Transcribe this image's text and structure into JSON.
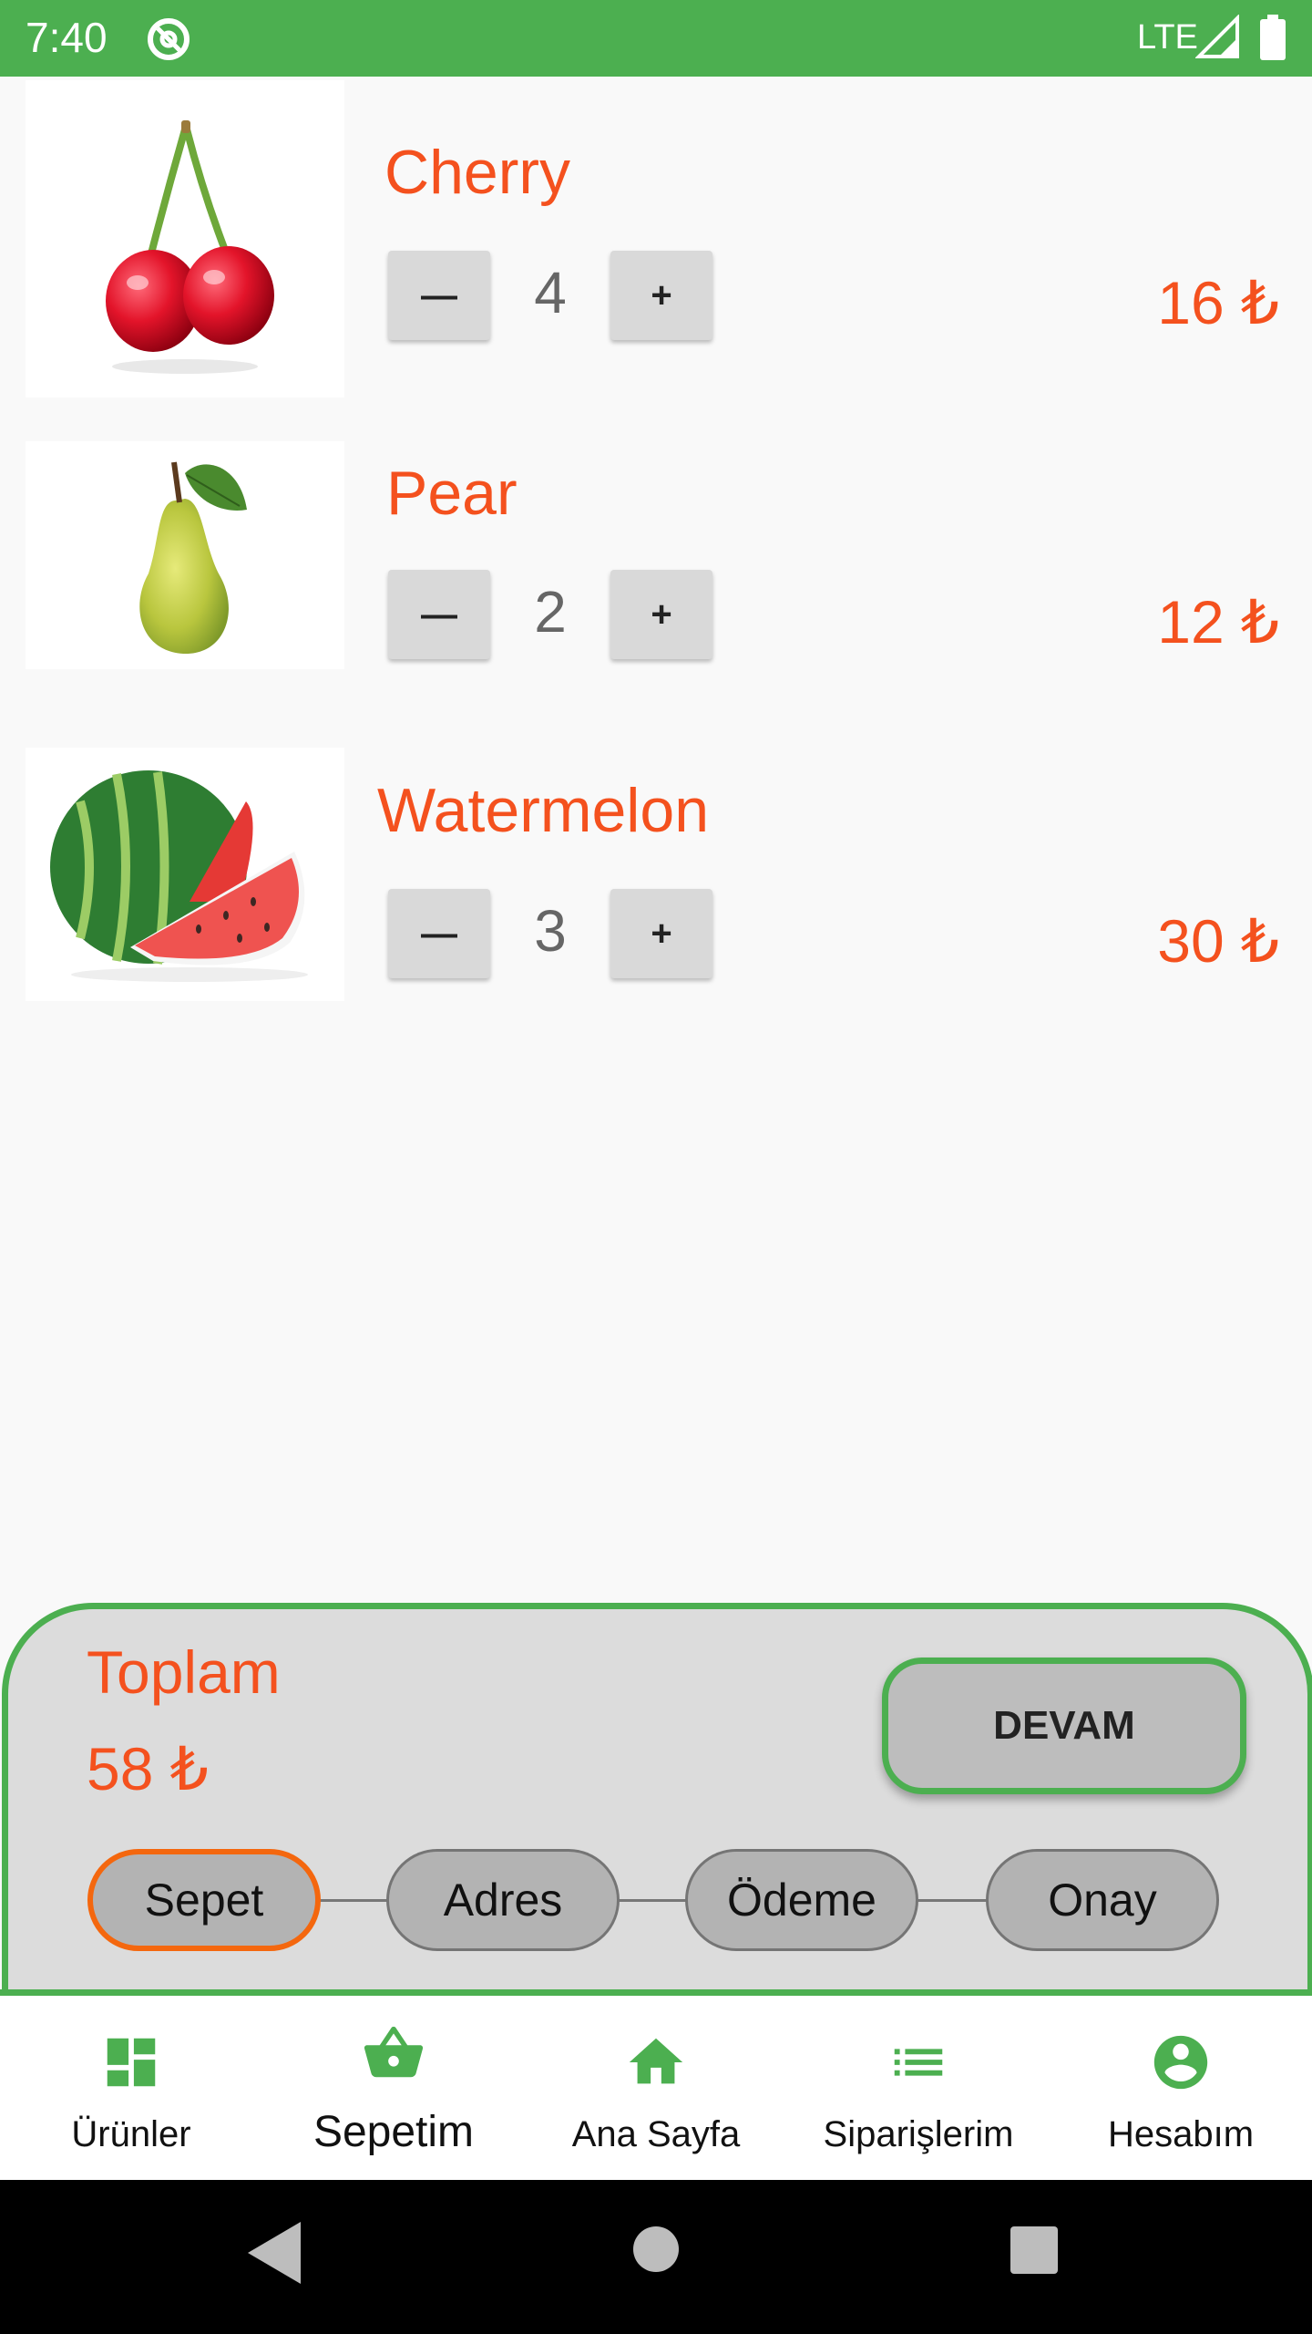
{
  "status_bar": {
    "time": "7:40",
    "network": "LTE",
    "background_color": "#4caf50"
  },
  "cart": {
    "items": [
      {
        "name": "Cherry",
        "quantity": "4",
        "price": "16 ₺",
        "image_icon": "cherry-image"
      },
      {
        "name": "Pear",
        "quantity": "2",
        "price": "12 ₺",
        "image_icon": "pear-image"
      },
      {
        "name": "Watermelon",
        "quantity": "3",
        "price": "30 ₺",
        "image_icon": "watermelon-image"
      }
    ],
    "minus_label": "—",
    "plus_label": "+"
  },
  "summary": {
    "total_label": "Toplam",
    "total_value": "58 ₺",
    "continue_label": "DEVAM",
    "steps": [
      {
        "label": "Sepet",
        "active": true
      },
      {
        "label": "Adres",
        "active": false
      },
      {
        "label": "Ödeme",
        "active": false
      },
      {
        "label": "Onay",
        "active": false
      }
    ]
  },
  "bottom_nav": {
    "items": [
      {
        "label": "Ürünler",
        "icon": "dashboard-icon",
        "active": false
      },
      {
        "label": "Sepetim",
        "icon": "basket-icon",
        "active": true
      },
      {
        "label": "Ana Sayfa",
        "icon": "home-icon",
        "active": false
      },
      {
        "label": "Siparişlerim",
        "icon": "list-icon",
        "active": false
      },
      {
        "label": "Hesabım",
        "icon": "account-icon",
        "active": false
      }
    ]
  },
  "colors": {
    "accent_orange": "#f4511e",
    "brand_green": "#4caf50",
    "panel_gray": "#dcdcdc"
  }
}
